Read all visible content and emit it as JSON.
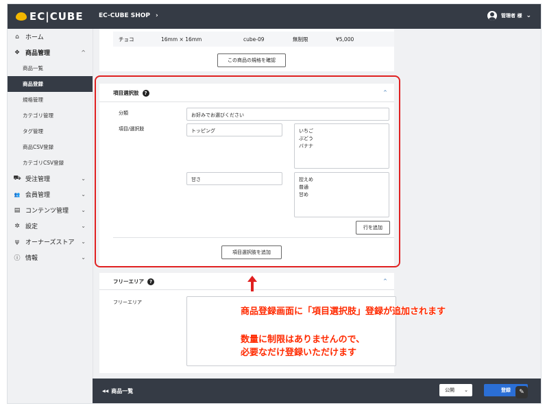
{
  "header": {
    "logo_text": "EC|CUBE",
    "shop_name": "EC-CUBE SHOP",
    "shop_chevron": "›",
    "user_name": "管理者 様",
    "user_chevron": "⌄"
  },
  "sidebar": {
    "items": [
      {
        "icon": "home-icon",
        "glyph": "⌂",
        "label": "ホーム"
      },
      {
        "icon": "box-icon",
        "glyph": "❖",
        "label": "商品管理",
        "chevron": "^"
      },
      {
        "icon": "cart-icon",
        "glyph": "⛟",
        "label": "受注管理",
        "chevron": "⌄"
      },
      {
        "icon": "users-icon",
        "glyph": "👥",
        "label": "会員管理",
        "chevron": "⌄"
      },
      {
        "icon": "file-icon",
        "glyph": "▤",
        "label": "コンテンツ管理",
        "chevron": "⌄"
      },
      {
        "icon": "gear-icon",
        "glyph": "✲",
        "label": "設定",
        "chevron": "⌄"
      },
      {
        "icon": "plug-icon",
        "glyph": "ψ",
        "label": "オーナーズストア",
        "chevron": "⌄"
      },
      {
        "icon": "info-icon",
        "glyph": "ⓘ",
        "label": "情報",
        "chevron": "⌄"
      }
    ],
    "product_sub": [
      "商品一覧",
      "商品登録",
      "規格管理",
      "カテゴリ管理",
      "タグ管理",
      "商品CSV登録",
      "カテゴリCSV登録"
    ],
    "active_sub": "商品登録"
  },
  "spec": {
    "row": {
      "name": "チョコ",
      "size": "16mm × 16mm",
      "code": "cube-09",
      "stock": "無制限",
      "price": "¥5,000"
    },
    "confirm_button": "この商品の規格を確認"
  },
  "options": {
    "title": "項目選択肢",
    "help": "?",
    "collapse": "^",
    "category_label": "分類",
    "category_value": "お好みでお選びください",
    "items_label": "項目/選択肢",
    "groups": [
      {
        "name": "トッピング",
        "choices": [
          "いちご",
          "ぶどう",
          "バナナ"
        ]
      },
      {
        "name": "甘さ",
        "choices": [
          "控えめ",
          "普通",
          "甘め"
        ]
      }
    ],
    "add_row_button": "行を追加",
    "add_option_button": "項目選択肢を追加"
  },
  "free_area": {
    "title": "フリーエリア",
    "help": "?",
    "collapse": "^",
    "label": "フリーエリア"
  },
  "annotation": {
    "line1": "商品登録画面に「項目選択肢」登録が追加されます",
    "line2": "数量に制限はありませんので、",
    "line3": "必要なだけ登録いただけます",
    "color": "#ff2a00"
  },
  "footer": {
    "back_glyph": "◀◀",
    "back_label": "商品一覧",
    "status_value": "公開",
    "status_chevron": "⌄",
    "submit_label": "登録"
  }
}
